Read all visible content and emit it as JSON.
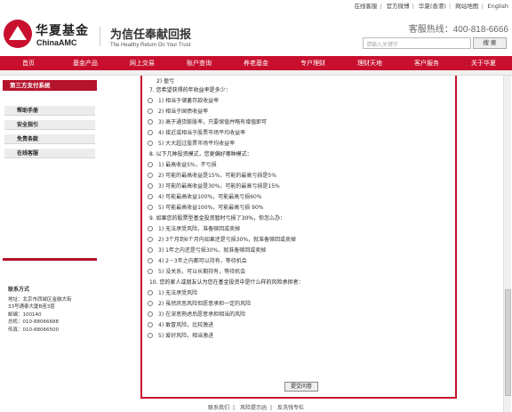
{
  "topbar": {
    "links": [
      "在线客服",
      "官方微博",
      "华夏(香港)",
      "网站地图",
      "English"
    ]
  },
  "header": {
    "logo_cn": "华夏基金",
    "logo_en": "ChinaAMC",
    "slogan_cn": "为信任奉献回报",
    "slogan_en": "The Healthy Return On Your Trust",
    "hotline": "客服热线：400-818-6666",
    "search_placeholder": "请输入关键字",
    "search_button": "搜 索"
  },
  "nav": [
    "首页",
    "基金产品",
    "网上交易",
    "账户查询",
    "养老基金",
    "专户理财",
    "理财天地",
    "客户服务",
    "关于华夏"
  ],
  "sidebar": {
    "title": "第三方支付系统",
    "items": [
      "帮助手册",
      "安全指引",
      "免责条款",
      "在线客服"
    ],
    "contact_title": "联系方式",
    "contact_lines": [
      "地址：北京市西城区金融大街",
      "33号通泰大厦B座3层",
      "邮编：100140",
      "总机：010-88066688",
      "传真：010-88066500"
    ]
  },
  "questionnaire": {
    "top_fragment": "2) 盈亏",
    "questions": [
      {
        "q": "7. 您希望获得的年收益率是多少：",
        "options": [
          "1) 相当于储蓄存款收益率",
          "2) 相当于国债收益率",
          "3) 高于通货膨胀率，只要保值并略有增值即可",
          "4) 接近或相当于股票市场平均收益率",
          "5) 大大超过股票市场平均收益率"
        ]
      },
      {
        "q": "8. 以下几种投资模式，您更偏好哪种模式：",
        "options": [
          "1) 最高收益5%，不亏损",
          "2) 可能的最高收益是15%，可能的最高亏损是5%",
          "3) 可能的最高收益是30%，可能的最高亏损是15%",
          "4) 可能最高收益100%，可能最高亏损60%",
          "5) 可能最高收益100%，可能最高亏损 90%"
        ]
      },
      {
        "q": "9. 如果您的股票型基金投资暂时亏损了30%，你怎么办：",
        "options": [
          "1) 无法承受风险，准备赎回或卖掉",
          "2) 3个月到6个月内如果还是亏损30%，就准备赎回或卖掉",
          "3) 1年之内还是亏损30%，就准备赎回或卖掉",
          "4) 2－3年之内都可以持有，等待机会",
          "5) 没关系，可以长期持有，等待机会"
        ]
      },
      {
        "q": "10. 您的家人或朋友认为您在基金投资中是什么样的风险承担者：",
        "options": [
          "1) 无法承受风险",
          "2) 虽然厌恶风险但愿意承担一定的风险",
          "3) 在深思熟虑后愿意承担相当的风险",
          "4) 敢冒风险，比较激进",
          "5) 爱好风险，相当激进"
        ]
      }
    ],
    "submit": "提交问卷"
  },
  "footer": {
    "links": [
      "联系我们",
      "风险提示函",
      "反洗钱专栏"
    ]
  },
  "colors": {
    "brand_red": "#c8102e"
  }
}
